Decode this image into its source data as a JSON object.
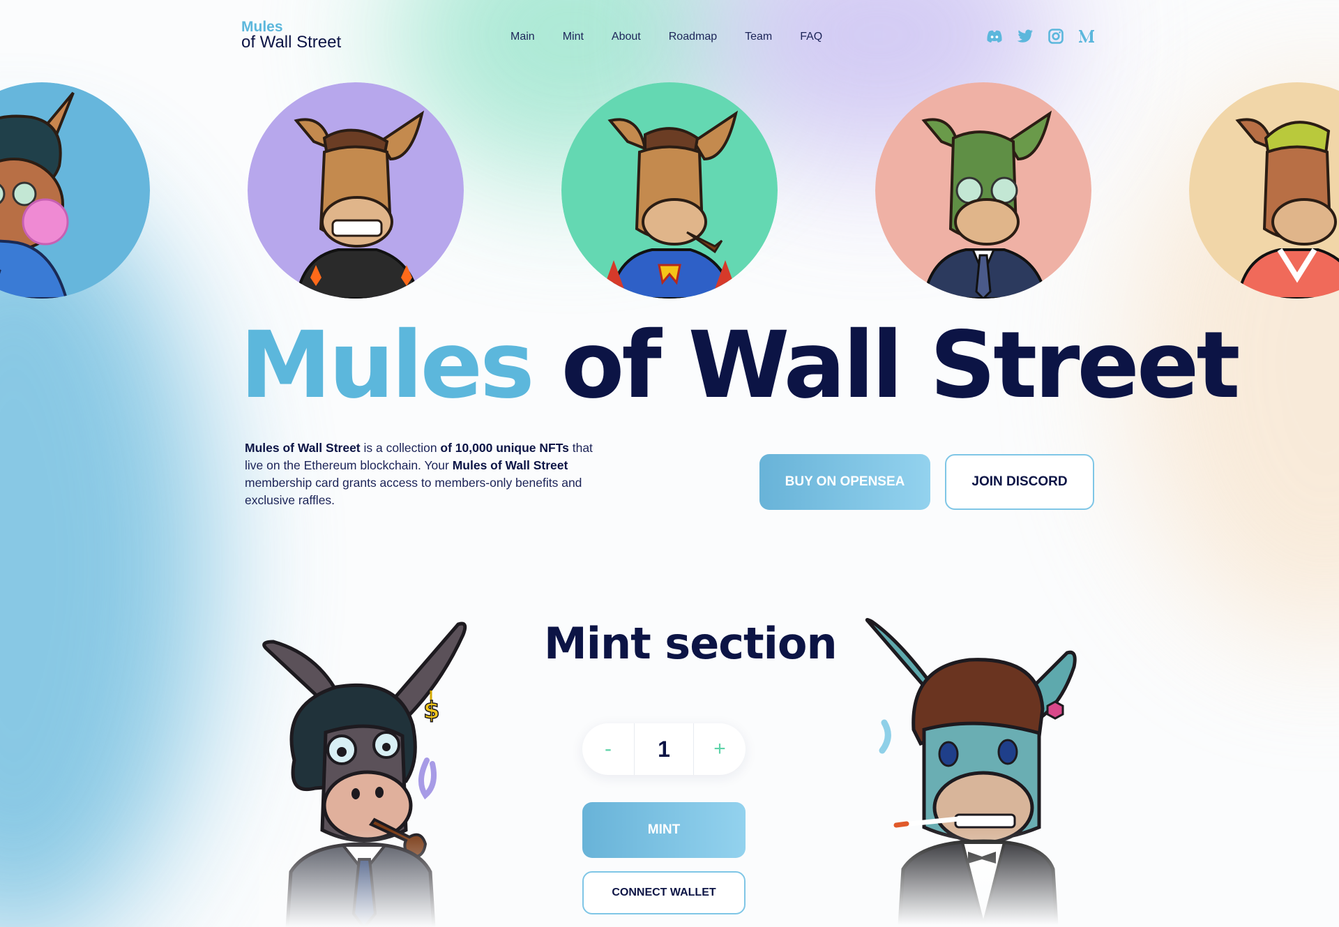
{
  "header": {
    "logo_line1": "Mules",
    "logo_line2": "of Wall Street",
    "nav": [
      "Main",
      "Mint",
      "About",
      "Roadmap",
      "Team",
      "FAQ"
    ],
    "socials": [
      "discord-icon",
      "twitter-icon",
      "instagram-icon",
      "medium-icon"
    ]
  },
  "avatars": [
    {
      "name": "mule-avatar-blue",
      "bg": "#66b6dc"
    },
    {
      "name": "mule-avatar-purple",
      "bg": "#b7a7ec"
    },
    {
      "name": "mule-avatar-green",
      "bg": "#64d8b2"
    },
    {
      "name": "mule-avatar-pink",
      "bg": "#efb1a5"
    },
    {
      "name": "mule-avatar-sand",
      "bg": "#f1d6a8"
    }
  ],
  "hero": {
    "title_accent": "Mules",
    "title_rest": " of Wall Street",
    "desc": {
      "b1": "Mules of Wall Street",
      "t1": " is a collection ",
      "b2": "of 10,000 unique NFTs",
      "t2": " that live on the Ethereum blockchain. Your ",
      "b3": "Mules of Wall Street",
      "t3": " membership card grants access to members-only benefits and exclusive raffles."
    },
    "buy_label": "BUY ON OPENSEA",
    "discord_label": "JOIN DISCORD"
  },
  "mint": {
    "title": "Mint section",
    "minus": "-",
    "quantity": "1",
    "plus": "+",
    "mint_label": "MINT",
    "connect_label": "CONNECT WALLET"
  },
  "colors": {
    "accent": "#5cb7dc",
    "navy": "#0c1445",
    "mint_green": "#5fd3a9"
  }
}
